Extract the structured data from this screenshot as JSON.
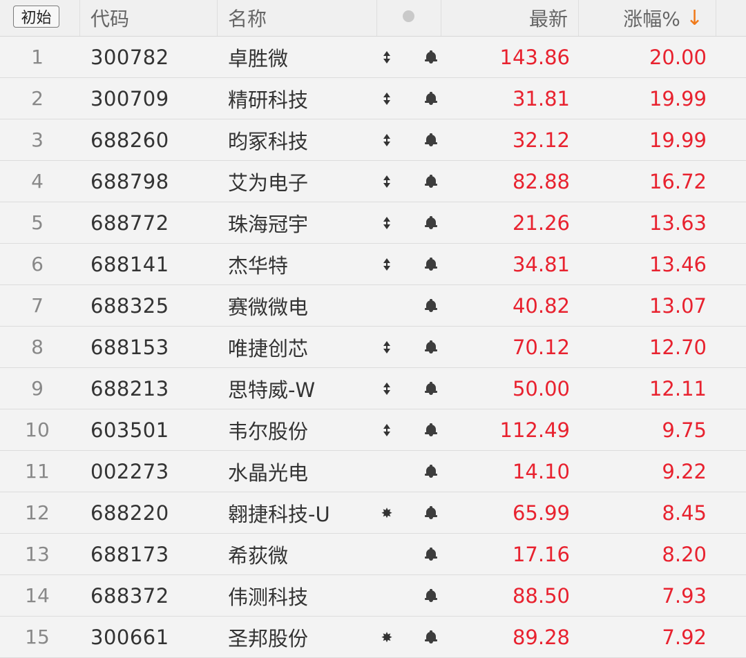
{
  "header": {
    "reset_label": "初始",
    "code_label": "代码",
    "name_label": "名称",
    "price_label": "最新",
    "pct_label": "涨幅%",
    "sort_arrow": "↓"
  },
  "colors": {
    "up": "#e8222f",
    "sort_arrow": "#f07a1a"
  },
  "rows": [
    {
      "idx": "1",
      "code": "300782",
      "name": "卓胜微",
      "mark": "updown",
      "price": "143.86",
      "pct": "20.00"
    },
    {
      "idx": "2",
      "code": "300709",
      "name": "精研科技",
      "mark": "updown",
      "price": "31.81",
      "pct": "19.99"
    },
    {
      "idx": "3",
      "code": "688260",
      "name": "昀冢科技",
      "mark": "updown",
      "price": "32.12",
      "pct": "19.99"
    },
    {
      "idx": "4",
      "code": "688798",
      "name": "艾为电子",
      "mark": "updown",
      "price": "82.88",
      "pct": "16.72"
    },
    {
      "idx": "5",
      "code": "688772",
      "name": "珠海冠宇",
      "mark": "updown",
      "price": "21.26",
      "pct": "13.63"
    },
    {
      "idx": "6",
      "code": "688141",
      "name": "杰华特",
      "mark": "updown",
      "price": "34.81",
      "pct": "13.46"
    },
    {
      "idx": "7",
      "code": "688325",
      "name": "赛微微电",
      "mark": "",
      "price": "40.82",
      "pct": "13.07"
    },
    {
      "idx": "8",
      "code": "688153",
      "name": "唯捷创芯",
      "mark": "updown",
      "price": "70.12",
      "pct": "12.70"
    },
    {
      "idx": "9",
      "code": "688213",
      "name": "思特威-W",
      "mark": "updown",
      "price": "50.00",
      "pct": "12.11"
    },
    {
      "idx": "10",
      "code": "603501",
      "name": "韦尔股份",
      "mark": "updown",
      "price": "112.49",
      "pct": "9.75"
    },
    {
      "idx": "11",
      "code": "002273",
      "name": "水晶光电",
      "mark": "",
      "price": "14.10",
      "pct": "9.22"
    },
    {
      "idx": "12",
      "code": "688220",
      "name": "翱捷科技-U",
      "mark": "star",
      "price": "65.99",
      "pct": "8.45"
    },
    {
      "idx": "13",
      "code": "688173",
      "name": "希荻微",
      "mark": "",
      "price": "17.16",
      "pct": "8.20"
    },
    {
      "idx": "14",
      "code": "688372",
      "name": "伟测科技",
      "mark": "",
      "price": "88.50",
      "pct": "7.93"
    },
    {
      "idx": "15",
      "code": "300661",
      "name": "圣邦股份",
      "mark": "star",
      "price": "89.28",
      "pct": "7.92"
    }
  ]
}
